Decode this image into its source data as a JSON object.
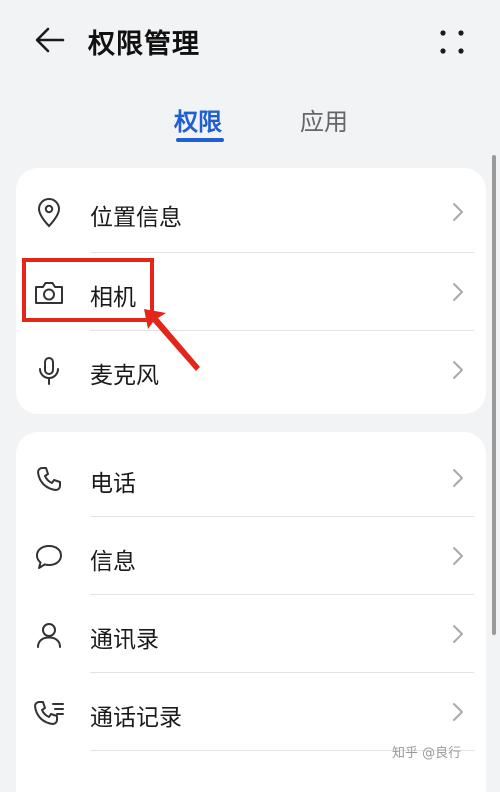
{
  "header": {
    "title": "权限管理"
  },
  "tabs": [
    {
      "label": "权限",
      "active": true
    },
    {
      "label": "应用",
      "active": false
    }
  ],
  "groups": [
    {
      "items": [
        {
          "label": "位置信息",
          "icon": "location-pin-icon"
        },
        {
          "label": "相机",
          "icon": "camera-icon",
          "highlighted": true
        },
        {
          "label": "麦克风",
          "icon": "microphone-icon"
        }
      ]
    },
    {
      "items": [
        {
          "label": "电话",
          "icon": "phone-icon"
        },
        {
          "label": "信息",
          "icon": "message-bubble-icon"
        },
        {
          "label": "通讯录",
          "icon": "contact-person-icon"
        },
        {
          "label": "通话记录",
          "icon": "call-log-icon"
        }
      ]
    }
  ],
  "watermark": "知乎 @良行",
  "colors": {
    "accent": "#1f5fd0",
    "annotation": "#e3261a",
    "background": "#f1f3f5"
  }
}
